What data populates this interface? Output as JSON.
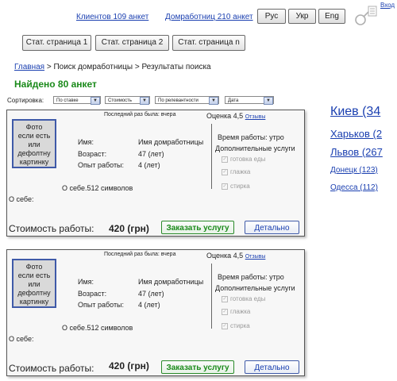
{
  "header": {
    "clients_link": "Клиентов 109 анкет",
    "housekeepers_link": "Домработниц 210 анкет",
    "languages": [
      "Рус",
      "Укр",
      "Eng"
    ],
    "login_label": "Вход",
    "static_pages": [
      "Стат. страница 1",
      "Стат. страница 2",
      "Стат. страница n"
    ]
  },
  "breadcrumb": {
    "home": "Главная",
    "separator": ">",
    "search": "Поиск домработницы",
    "results": "Результаты поиска"
  },
  "results": {
    "found_text": "Найдено 80 анкет"
  },
  "sorting": {
    "label": "Сортировка:",
    "options": [
      "По ставке",
      "Стоимость",
      "По релевантности",
      "Дата"
    ]
  },
  "cards": [
    {
      "photo_text": [
        "Фото",
        "если есть",
        "или",
        "дефолтну",
        "картинку"
      ],
      "last_seen": "Последний раз была: вчера",
      "rating": "Оценка 4,5",
      "reviews_link": "Отзывы",
      "name_label": "Имя:",
      "name_value": "Имя домработницы",
      "age_label": "Возраст:",
      "age_value": "47 (лет)",
      "experience_label": "Опыт работы:",
      "experience_value": "4 (лет)",
      "about_summary": "О себе.512 символов",
      "about_label": "О себе:",
      "work_time": "Время работы:  утро",
      "extra_services_label": "Дополнительные услуги",
      "services": [
        "готовка еды",
        "глажка",
        "стирка"
      ],
      "cost_label": "Стоимость работы:",
      "price": "420 (грн)",
      "order_button": "Заказать услугу",
      "detail_button": "Детально"
    },
    {
      "photo_text": [
        "Фото",
        "если есть",
        "или",
        "дефолтну",
        "картинку"
      ],
      "last_seen": "Последний раз была: вчера",
      "rating": "Оценка 4,5",
      "reviews_link": "Отзывы",
      "name_label": "Имя:",
      "name_value": "Имя домработницы",
      "age_label": "Возраст:",
      "age_value": "47 (лет)",
      "experience_label": "Опыт работы:",
      "experience_value": "4 (лет)",
      "about_summary": "О себе.512 символов",
      "about_label": "О себе:",
      "work_time": "Время работы:  утро",
      "extra_services_label": "Дополнительные услуги",
      "services": [
        "готовка еды",
        "глажка",
        "стирка"
      ],
      "cost_label": "Стоимость работы:",
      "price": "420 (грн)",
      "order_button": "Заказать услугу",
      "detail_button": "Детально"
    }
  ],
  "cities": [
    {
      "name": "Киев (34",
      "size": "large"
    },
    {
      "name": "Харьков (2",
      "size": "medium"
    },
    {
      "name": "Львов (267",
      "size": "medium"
    },
    {
      "name": "Донецк (123)",
      "size": "small"
    },
    {
      "name": "Одесса (112)",
      "size": "small"
    }
  ],
  "colors": {
    "link": "#1a3fb0",
    "accent_green": "#1a8a1a",
    "photo_border": "#3f5aa8"
  }
}
